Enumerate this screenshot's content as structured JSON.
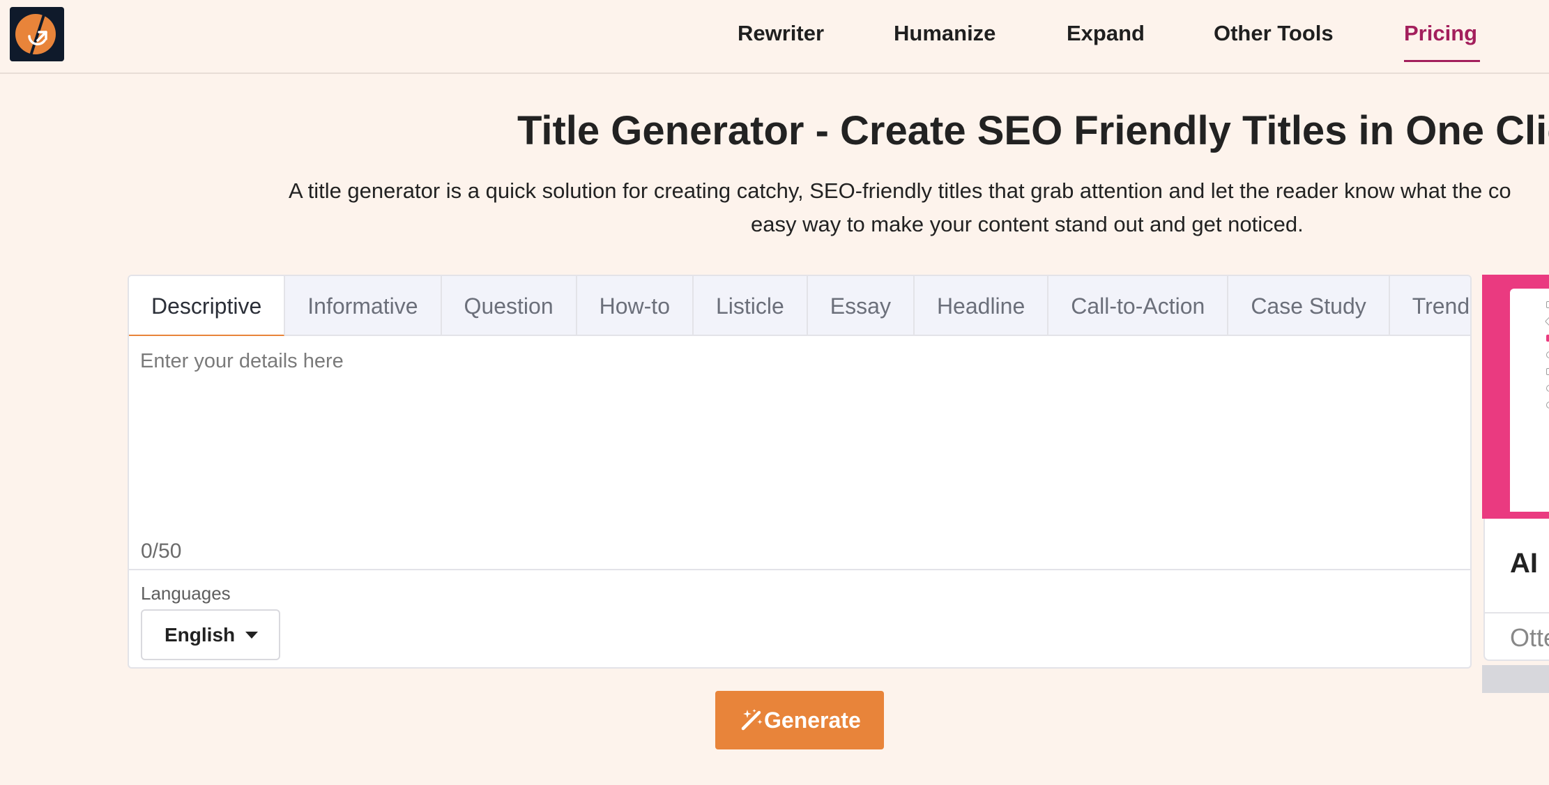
{
  "header": {
    "nav": [
      {
        "label": "Rewriter"
      },
      {
        "label": "Humanize"
      },
      {
        "label": "Expand"
      },
      {
        "label": "Other Tools"
      },
      {
        "label": "Pricing",
        "active": true
      }
    ]
  },
  "hero": {
    "title": "Title Generator - Create SEO Friendly Titles in One Click",
    "description_line1": "A title generator is a quick solution for creating catchy, SEO-friendly titles that grab attention and let the reader know what the co",
    "description_line2": "easy way to make your content stand out and get noticed."
  },
  "tool": {
    "tabs": [
      {
        "label": "Descriptive",
        "active": true
      },
      {
        "label": "Informative"
      },
      {
        "label": "Question"
      },
      {
        "label": "How-to"
      },
      {
        "label": "Listicle"
      },
      {
        "label": "Essay"
      },
      {
        "label": "Headline"
      },
      {
        "label": "Call-to-Action"
      },
      {
        "label": "Case Study"
      },
      {
        "label": "Trend"
      }
    ],
    "input": {
      "placeholder": "Enter your details here",
      "value": ""
    },
    "counter": "0/50",
    "languages": {
      "label": "Languages",
      "selected": "English"
    },
    "generate_label": "Generate"
  },
  "promo": {
    "title_partial": "AI",
    "subtitle_partial": "Otte"
  },
  "colors": {
    "background": "#fdf3ec",
    "accent_orange": "#e8843a",
    "accent_pink": "#a31f5c",
    "promo_pink": "#ea3a80"
  },
  "icons": {
    "logo": "brand-logo-icon",
    "wand": "magic-wand-icon",
    "caret": "caret-down-icon"
  }
}
